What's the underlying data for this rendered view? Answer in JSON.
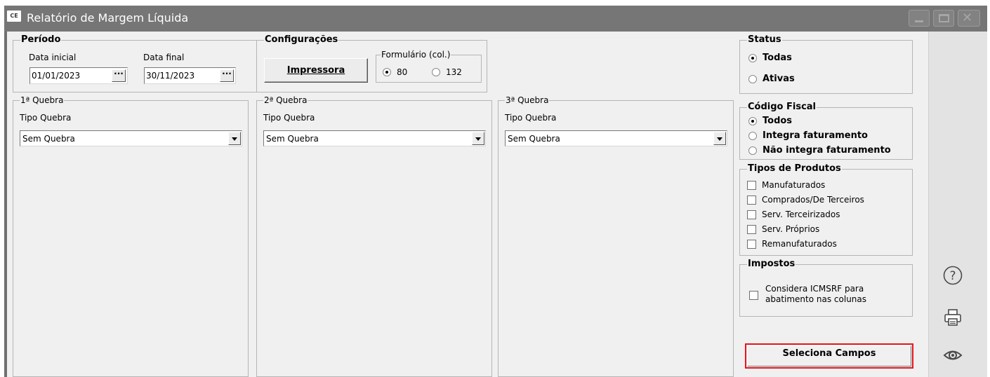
{
  "window": {
    "app_icon_text": "CE",
    "title": "Relatório de Margem Líquida",
    "controls": {
      "minimize": "minimize",
      "maximize": "maximize",
      "close": "✕"
    }
  },
  "periodo": {
    "title": "Período",
    "data_inicial_label": "Data inicial",
    "data_inicial_value": "01/01/2023",
    "data_final_label": "Data final",
    "data_final_value": "30/11/2023",
    "picker_label": "···"
  },
  "configuracoes": {
    "title": "Configurações",
    "impressora_label": "Impressora",
    "formulario": {
      "title": "Formulário (col.)",
      "options": [
        {
          "label": "80",
          "selected": true
        },
        {
          "label": "132",
          "selected": false
        }
      ]
    }
  },
  "quebras": [
    {
      "title": "1ª Quebra",
      "tipo_label": "Tipo Quebra",
      "value": "Sem Quebra"
    },
    {
      "title": "2ª Quebra",
      "tipo_label": "Tipo Quebra",
      "value": "Sem Quebra"
    },
    {
      "title": "3ª Quebra",
      "tipo_label": "Tipo Quebra",
      "value": "Sem Quebra"
    }
  ],
  "status": {
    "title": "Status",
    "options": [
      {
        "label": "Todas",
        "selected": true
      },
      {
        "label": "Ativas",
        "selected": false
      }
    ]
  },
  "codigo_fiscal": {
    "title": "Código Fiscal",
    "options": [
      {
        "label": "Todos",
        "selected": true
      },
      {
        "label": "Integra faturamento",
        "selected": false
      },
      {
        "label": "Não integra faturamento",
        "selected": false
      }
    ]
  },
  "tipos_produtos": {
    "title": "Tipos de Produtos",
    "items": [
      {
        "label": "Manufaturados",
        "checked": false
      },
      {
        "label": "Comprados/De Terceiros",
        "checked": false
      },
      {
        "label": "Serv. Terceirizados",
        "checked": false
      },
      {
        "label": "Serv. Próprios",
        "checked": false
      },
      {
        "label": "Remanufaturados",
        "checked": false
      }
    ]
  },
  "impostos": {
    "title": "Impostos",
    "considera_line1": "Considera ICMSRF para",
    "considera_line2": "abatimento nas colunas",
    "checked": false
  },
  "seleciona_campos_label": "Seleciona Campos",
  "sidebar": {
    "help_icon": "?",
    "print_icon": "printer",
    "preview_icon": "eye"
  },
  "colors": {
    "highlight": "#e8141c",
    "titlebar": "#767676",
    "panel": "#f0f0f0"
  }
}
